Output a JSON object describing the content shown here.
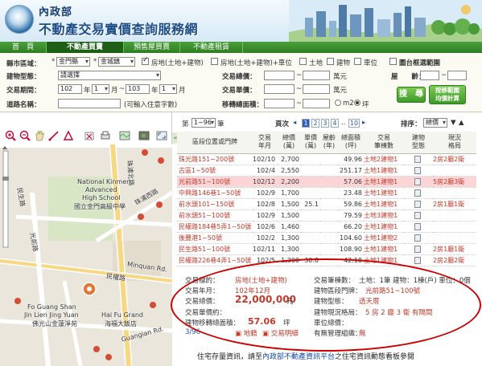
{
  "header": {
    "org": "內政部",
    "title": "不動產交易實價查詢服務網"
  },
  "tabs": [
    {
      "label": "首　頁"
    },
    {
      "label": "不動產買賣"
    },
    {
      "label": "預售屋買賣"
    },
    {
      "label": "不動產租賃"
    }
  ],
  "search": {
    "area_label": "縣市區域：",
    "city": "金門縣",
    "district": "金城鎮",
    "types": [
      {
        "label": "房地(土地+建物)",
        "checked": true
      },
      {
        "label": "房地(土地+建物)+車位",
        "checked": false
      },
      {
        "label": "土地",
        "checked": false
      },
      {
        "label": "建物",
        "checked": false
      },
      {
        "label": "車位",
        "checked": false
      }
    ],
    "map_range_label": "圖台框選範圍",
    "building_type_label": "建物型態：",
    "building_type_value": "請選擇",
    "total_price_label": "交易總價：",
    "total_unit": "萬元",
    "age_label": "屋　　齡：",
    "unit_price_label": "交易單價：",
    "unit_price_unit": "萬元",
    "period_label": "交易期間：",
    "period_from_year": "102",
    "period_from_month": "1",
    "period_to_year": "103",
    "period_to_month": "1",
    "year_label": "年",
    "month_label": "月",
    "tilde": "~",
    "road_label": "道路名稱：",
    "road_hint": "(可輸入住意字數)",
    "area_label2": "移轉總面積：",
    "sqm_label": "m2",
    "ping_label": "坪",
    "search_btn": "搜　尋",
    "map_btn": "按移範圍\n均價計算"
  },
  "results": {
    "range_label": "第",
    "range_value": "1~96",
    "range_suffix": "筆",
    "page_label": "頁次",
    "pages": [
      "1",
      "2",
      "3",
      "4",
      "10"
    ],
    "ellipsis": "..",
    "sort_label": "排序：",
    "sort_value": "總價",
    "columns": [
      "區段位置或門牌",
      "交易\n年月",
      "總價\n(萬)",
      "單價\n(萬)",
      "屋齡\n(年)",
      "總面積\n(坪)",
      "交易\n筆棟數",
      "建物\n型態",
      "現況\n格局"
    ],
    "rows": [
      {
        "addr": "珠光路151~200號",
        "ym": "102/10",
        "total": "2,700",
        "unit": "",
        "age": "",
        "area": "49.96",
        "deal": "土地2建物1",
        "layout": "2房2廳2衛",
        "hl": false
      },
      {
        "addr": "古區1~50號",
        "ym": "102/4",
        "total": "2,550",
        "unit": "",
        "age": "",
        "area": "251.17",
        "deal": "土地1建物1",
        "layout": "",
        "hl": false
      },
      {
        "addr": "光前路51~100號",
        "ym": "102/12",
        "total": "2,200",
        "unit": "",
        "age": "",
        "area": "57.06",
        "deal": "土地1建物1",
        "layout": "5房2廳3衛",
        "hl": true
      },
      {
        "addr": "中興路146巷1~50號",
        "ym": "102/9",
        "total": "1,700",
        "unit": "",
        "age": "",
        "area": "23.48",
        "deal": "土地1建物1",
        "layout": "",
        "hl": false
      },
      {
        "addr": "前水頭101~150號",
        "ym": "102/8",
        "total": "1,500",
        "unit": "25.1",
        "age": "",
        "area": "59.86",
        "deal": "土地1建物1",
        "layout": "2房1廳1衛",
        "hl": false
      },
      {
        "addr": "前水頭51~100號",
        "ym": "102/9",
        "total": "1,500",
        "unit": "",
        "age": "",
        "area": "79.59",
        "deal": "土地3建物1",
        "layout": "",
        "hl": false
      },
      {
        "addr": "民權路184巷5弄1~50號",
        "ym": "102/6",
        "total": "1,460",
        "unit": "",
        "age": "",
        "area": "66.20",
        "deal": "土地1建物1",
        "layout": "",
        "hl": false
      },
      {
        "addr": "後豐港1~50號",
        "ym": "102/2",
        "total": "1,300",
        "unit": "",
        "age": "",
        "area": "104.60",
        "deal": "土地1建物2",
        "layout": "",
        "hl": false
      },
      {
        "addr": "民生路51~100號",
        "ym": "102/11",
        "total": "1,300",
        "unit": "",
        "age": "",
        "area": "108.90",
        "deal": "土地1建物1",
        "layout": "2房1廳1衛",
        "hl": false
      },
      {
        "addr": "民權路226巷4弄1~50號",
        "ym": "102/5",
        "total": "1,300",
        "unit": "30.8",
        "age": "",
        "area": "42.18",
        "deal": "土地1建物1",
        "layout": "2房2廳2衛",
        "hl": false
      }
    ]
  },
  "detail": {
    "type_label": "交易標的：",
    "type_value": "房地(土地+建物)",
    "ym_label": "交易年月：",
    "ym_value": "102年12月",
    "total_label": "交易總價：",
    "total_value": "22,000,000",
    "total_unit": "元",
    "unit_label": "交易單價約：",
    "area_label": "建物移轉總面積：",
    "area_value": "57.06",
    "area_unit": "坪",
    "count_label": "交易筆棟數：",
    "count_value": "土地：1筆 建物：1棟(戶) 車位：0個",
    "addr_label": "建物區段門牌：",
    "addr_value": "光前路51~100號",
    "btype_label": "建物型態：",
    "btype_value": "透天厝",
    "layout_label": "建物現況格局：",
    "layout_value": "5 房 2 廳 3 衛 有隔間",
    "parking_label": "車位總價：",
    "mgmt_label": "有無管理組織：",
    "mgmt_value": "無",
    "index": "3/96",
    "land_btn": "地籍",
    "detail_btn": "交易明細"
  },
  "footer": {
    "prefix": "住宅存量資訊，請至",
    "link": "內政部不動產資訊平台",
    "suffix": "之住宅資訊動態看板參閱"
  },
  "map": {
    "labels": [
      "National Kinmen",
      "Advanced",
      "High School",
      "國立金門高級中學",
      "光前路",
      "民權路",
      "Minquan Rd.",
      "Fo Guang Shan",
      "Jin Lien Jing Yuan",
      "佛光山金蓮淨苑",
      "Hai Fu Grand",
      "海福大飯店",
      "珠浦北路",
      "珠浦西路",
      "民生路",
      "Guangian Rd."
    ]
  }
}
